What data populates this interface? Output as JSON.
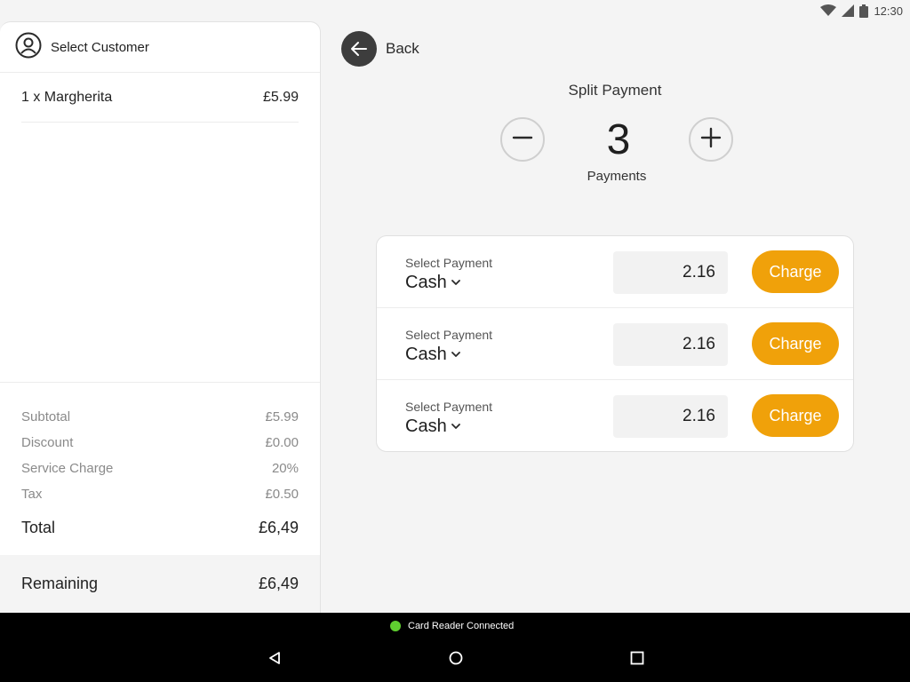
{
  "status_bar": {
    "time": "12:30",
    "icons": [
      "wifi-icon",
      "signal-icon",
      "battery-icon"
    ]
  },
  "left_panel": {
    "customer_label": "Select Customer",
    "items": [
      {
        "name": "1 x Margherita",
        "price": "£5.99"
      }
    ],
    "totals": [
      {
        "label": "Subtotal",
        "value": "£5.99"
      },
      {
        "label": "Discount",
        "value": "£0.00"
      },
      {
        "label": "Service Charge",
        "value": "20%"
      },
      {
        "label": "Tax",
        "value": "£0.50"
      }
    ],
    "total": {
      "label": "Total",
      "value": "£6,49"
    },
    "remaining": {
      "label": "Remaining",
      "value": "£6,49"
    }
  },
  "header": {
    "back_label": "Back"
  },
  "split": {
    "title": "Split Payment",
    "count": "3",
    "count_label": "Payments"
  },
  "payments": [
    {
      "caption": "Select Payment",
      "method": "Cash",
      "amount": "2.16",
      "action": "Charge"
    },
    {
      "caption": "Select Payment",
      "method": "Cash",
      "amount": "2.16",
      "action": "Charge"
    },
    {
      "caption": "Select Payment",
      "method": "Cash",
      "amount": "2.16",
      "action": "Charge"
    }
  ],
  "footer": {
    "reader_status": "Card Reader Connected",
    "status_color": "#5fce30"
  },
  "colors": {
    "accent": "#f0a10a",
    "dark_button": "#3d3d3d"
  }
}
